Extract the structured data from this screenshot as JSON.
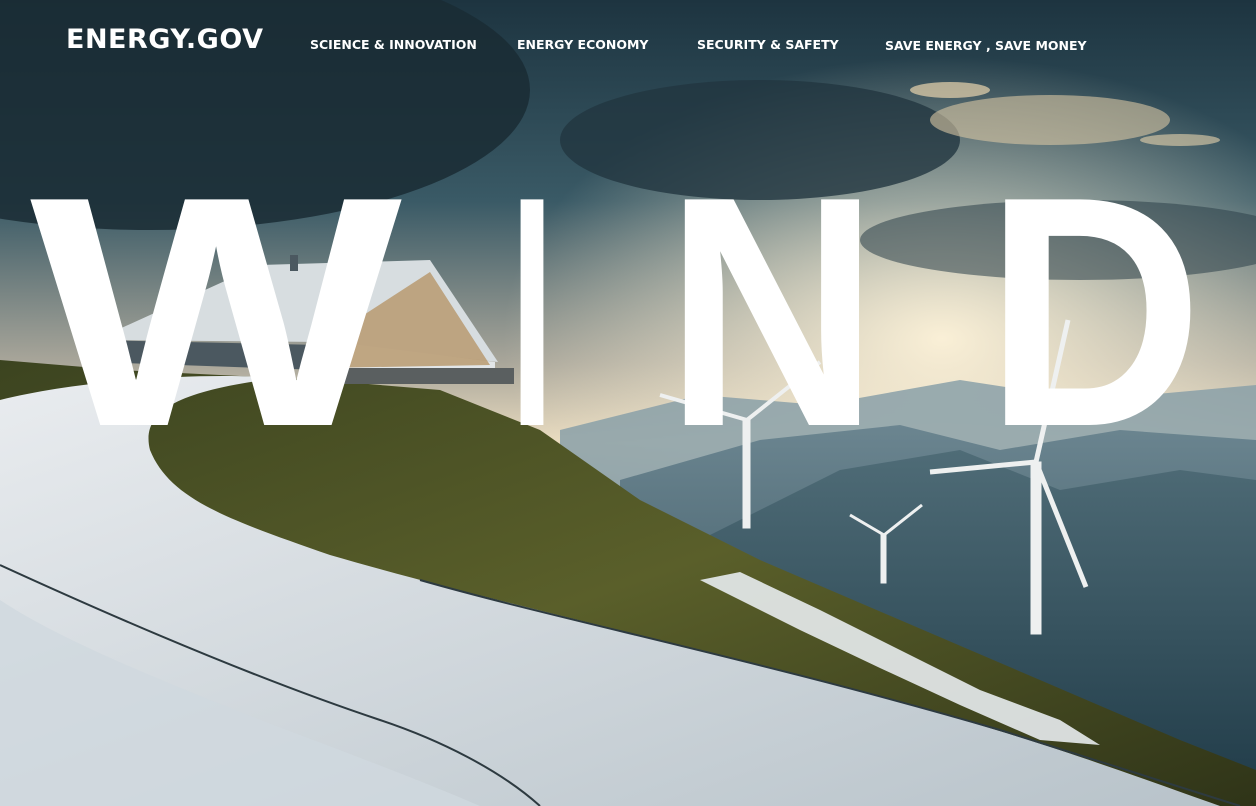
{
  "brand": {
    "logo_text": "ENERGY.GOV"
  },
  "nav": {
    "items": [
      {
        "label": "SCIENCE & INNOVATION"
      },
      {
        "label": "ENERGY ECONOMY"
      },
      {
        "label": "SECURITY & SAFETY"
      },
      {
        "label": "SAVE ENERGY , SAVE MONEY"
      }
    ]
  },
  "hero": {
    "word": "WIND",
    "letters": [
      "W",
      "I",
      "N",
      "D"
    ]
  },
  "colors": {
    "sky_top": "#1f3540",
    "sky_glow": "#e8dcc0",
    "mountain": "#3e5a66",
    "grass": "#4a4f24",
    "road": "#dfe3e6",
    "text": "#ffffff"
  },
  "icons": {
    "turbine": "wind-turbine-icon",
    "house": "house-icon"
  }
}
